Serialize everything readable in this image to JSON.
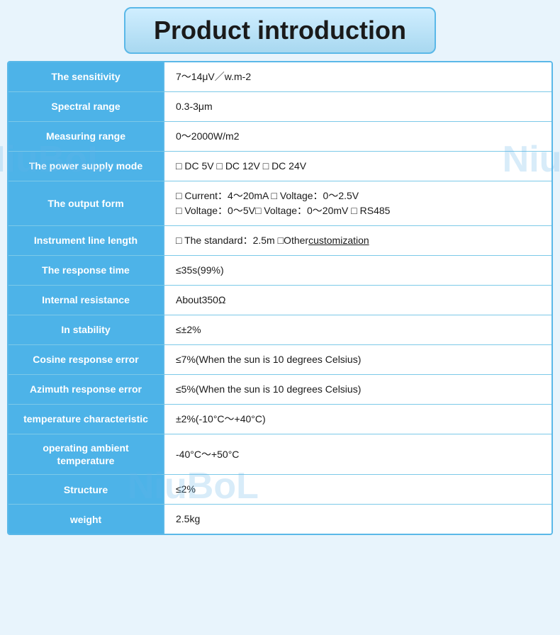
{
  "title": "Product introduction",
  "watermarks": [
    "NiuBoL",
    "NiuB",
    "NiuBoL"
  ],
  "rows": [
    {
      "label": "The sensitivity",
      "value": "7～14μV／w.m-2",
      "multiline": false
    },
    {
      "label": "Spectral range",
      "value": "0.3-3μm",
      "multiline": false
    },
    {
      "label": "Measuring range",
      "value": "0～2000W/m2",
      "multiline": false
    },
    {
      "label": "The power supply mode",
      "value": "□ DC 5V  □ DC 12V  □ DC 24V",
      "multiline": false
    },
    {
      "label": "The output form",
      "value_lines": [
        "□ Current：4～20mA □ Voltage：0～2.5V",
        "□ Voltage：0～5V□ Voltage：0～20mV □ RS485"
      ],
      "multiline": true
    },
    {
      "label": "Instrument line length",
      "value": "□ The standard：2.5m □Other customization",
      "multiline": false,
      "has_underline_word": "customization"
    },
    {
      "label": "The response time",
      "value": "≤35s(99%)",
      "multiline": false
    },
    {
      "label": "Internal resistance",
      "value": "About350Ω",
      "multiline": false
    },
    {
      "label": "In stability",
      "value": "≤±2%",
      "multiline": false
    },
    {
      "label": "Cosine response error",
      "value": "≤7%(When the sun is 10 degrees Celsius)",
      "multiline": false
    },
    {
      "label": "Azimuth response error",
      "value": "≤5%(When the sun is 10 degrees Celsius)",
      "multiline": false
    },
    {
      "label": "temperature characteristic",
      "value": "±2%(-10°C～+40°C)",
      "multiline": false
    },
    {
      "label": "operating ambient temperature",
      "value": "-40°C～+50°C",
      "multiline": false
    },
    {
      "label": "Structure",
      "value": "≤2%",
      "multiline": false
    },
    {
      "label": "weight",
      "value": "2.5kg",
      "multiline": false
    }
  ]
}
